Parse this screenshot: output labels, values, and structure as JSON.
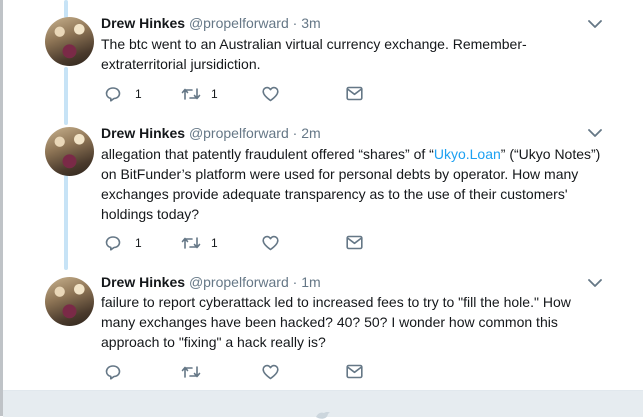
{
  "tweets": [
    {
      "name": "Drew Hinkes",
      "handle": "@propelforward",
      "separator": "·",
      "time": "3m",
      "text": "The btc went to an Australian virtual currency exchange. Remember- extraterritorial jursidiction.",
      "replies": "1",
      "retweets": "1"
    },
    {
      "name": "Drew Hinkes",
      "handle": "@propelforward",
      "separator": "·",
      "time": "2m",
      "text_before": "allegation that patently fraudulent offered “shares” of “",
      "link": "Ukyo.Loan",
      "text_after": "” (“Ukyo Notes”) on BitFunder’s platform were used for personal debts by operator. How many exchanges provide adequate transparency as to the use of their customers' holdings today?",
      "replies": "1",
      "retweets": "1"
    },
    {
      "name": "Drew Hinkes",
      "handle": "@propelforward",
      "separator": "·",
      "time": "1m",
      "text": "failure to report cyberattack led to increased fees to try to \"fill the hole.\" How many exchanges have been hacked? 40? 50?  I wonder how common this approach to \"fixing\" a hack really is?",
      "replies": "",
      "retweets": ""
    }
  ],
  "colors": {
    "link": "#1da1f2",
    "thread_line": "#c7e3f6",
    "meta": "#657786",
    "footer": "#e6ecf0"
  },
  "icons": [
    "reply-icon",
    "retweet-icon",
    "like-icon",
    "dm-icon",
    "chevron-down-icon",
    "twitter-bird-icon"
  ]
}
